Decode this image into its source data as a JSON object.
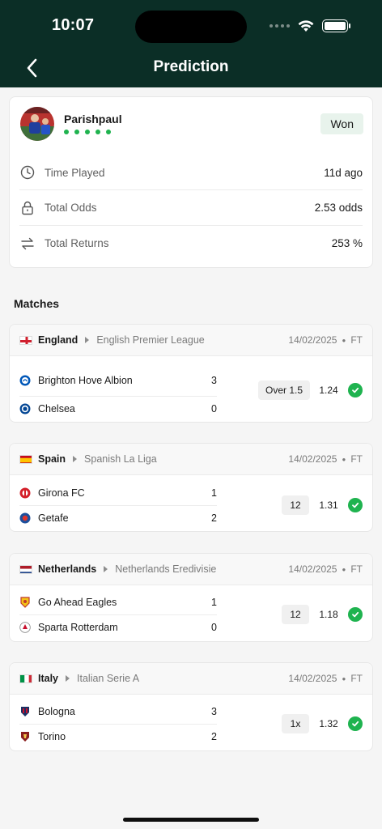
{
  "status": {
    "time": "10:07"
  },
  "header": {
    "title": "Prediction"
  },
  "user": {
    "name": "Parishpaul",
    "result": "Won",
    "form_dots": 5
  },
  "stats": [
    {
      "label": "Time Played",
      "value": "11d ago",
      "icon": "clock-icon"
    },
    {
      "label": "Total Odds",
      "value": "2.53 odds",
      "icon": "lock-icon"
    },
    {
      "label": "Total Returns",
      "value": "253 %",
      "icon": "swap-icon"
    }
  ],
  "matches_title": "Matches",
  "matches": [
    {
      "country": "England",
      "league": "English Premier League",
      "date": "14/02/2025",
      "status": "FT",
      "home": {
        "name": "Brighton Hove Albion",
        "score": "3"
      },
      "away": {
        "name": "Chelsea",
        "score": "0"
      },
      "pick": "Over 1.5",
      "odds": "1.24"
    },
    {
      "country": "Spain",
      "league": "Spanish La Liga",
      "date": "14/02/2025",
      "status": "FT",
      "home": {
        "name": "Girona FC",
        "score": "1"
      },
      "away": {
        "name": "Getafe",
        "score": "2"
      },
      "pick": "12",
      "odds": "1.31"
    },
    {
      "country": "Netherlands",
      "league": "Netherlands Eredivisie",
      "date": "14/02/2025",
      "status": "FT",
      "home": {
        "name": "Go Ahead Eagles",
        "score": "1"
      },
      "away": {
        "name": "Sparta Rotterdam",
        "score": "0"
      },
      "pick": "12",
      "odds": "1.18"
    },
    {
      "country": "Italy",
      "league": "Italian Serie A",
      "date": "14/02/2025",
      "status": "FT",
      "home": {
        "name": "Bologna",
        "score": "3"
      },
      "away": {
        "name": "Torino",
        "score": "2"
      },
      "pick": "1x",
      "odds": "1.32"
    }
  ],
  "colors": {
    "header": "#0b2e26",
    "success": "#1fb34f"
  }
}
